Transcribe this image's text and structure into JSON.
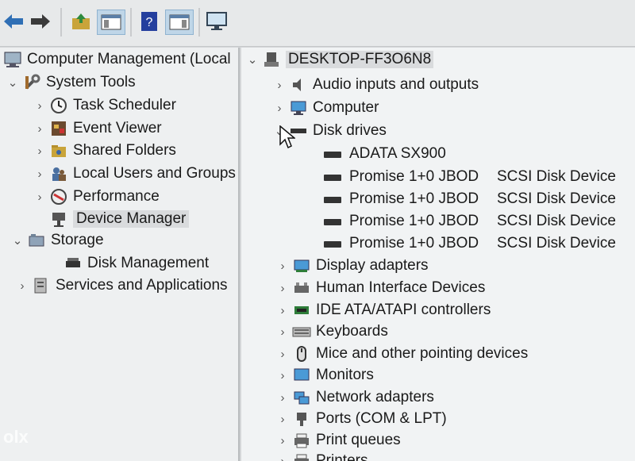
{
  "toolbar": {
    "icons": [
      "back-arrow-icon",
      "forward-arrow-icon",
      "up-folder-icon",
      "show-hide-console-tree-icon",
      "help-icon",
      "action-pane-icon",
      "monitor-icon"
    ]
  },
  "tree": {
    "root": "Computer Management (Local",
    "system_tools": "System Tools",
    "task_scheduler": "Task Scheduler",
    "event_viewer": "Event Viewer",
    "shared_folders": "Shared Folders",
    "local_users": "Local Users and Groups",
    "performance": "Performance",
    "device_manager": "Device Manager",
    "storage": "Storage",
    "disk_management": "Disk Management",
    "services": "Services and Applications"
  },
  "devices": {
    "computer_name": "DESKTOP-FF3O6N8",
    "categories": {
      "audio": "Audio inputs and outputs",
      "computer": "Computer",
      "disk": "Disk drives",
      "display": "Display adapters",
      "hid": "Human Interface Devices",
      "ide": "IDE ATA/ATAPI controllers",
      "keyboards": "Keyboards",
      "mice": "Mice and other pointing devices",
      "monitors": "Monitors",
      "network": "Network adapters",
      "ports": "Ports (COM & LPT)",
      "print_queues": "Print queues",
      "printers": "Printers"
    },
    "disks": [
      {
        "name": "ADATA SX900",
        "suffix": ""
      },
      {
        "name": "Promise  1+0 JBOD",
        "suffix": "SCSI Disk Device"
      },
      {
        "name": "Promise  1+0 JBOD",
        "suffix": "SCSI Disk Device"
      },
      {
        "name": "Promise  1+0 JBOD",
        "suffix": "SCSI Disk Device"
      },
      {
        "name": "Promise  1+0 JBOD",
        "suffix": "SCSI Disk Device"
      }
    ]
  },
  "watermark": "olx"
}
